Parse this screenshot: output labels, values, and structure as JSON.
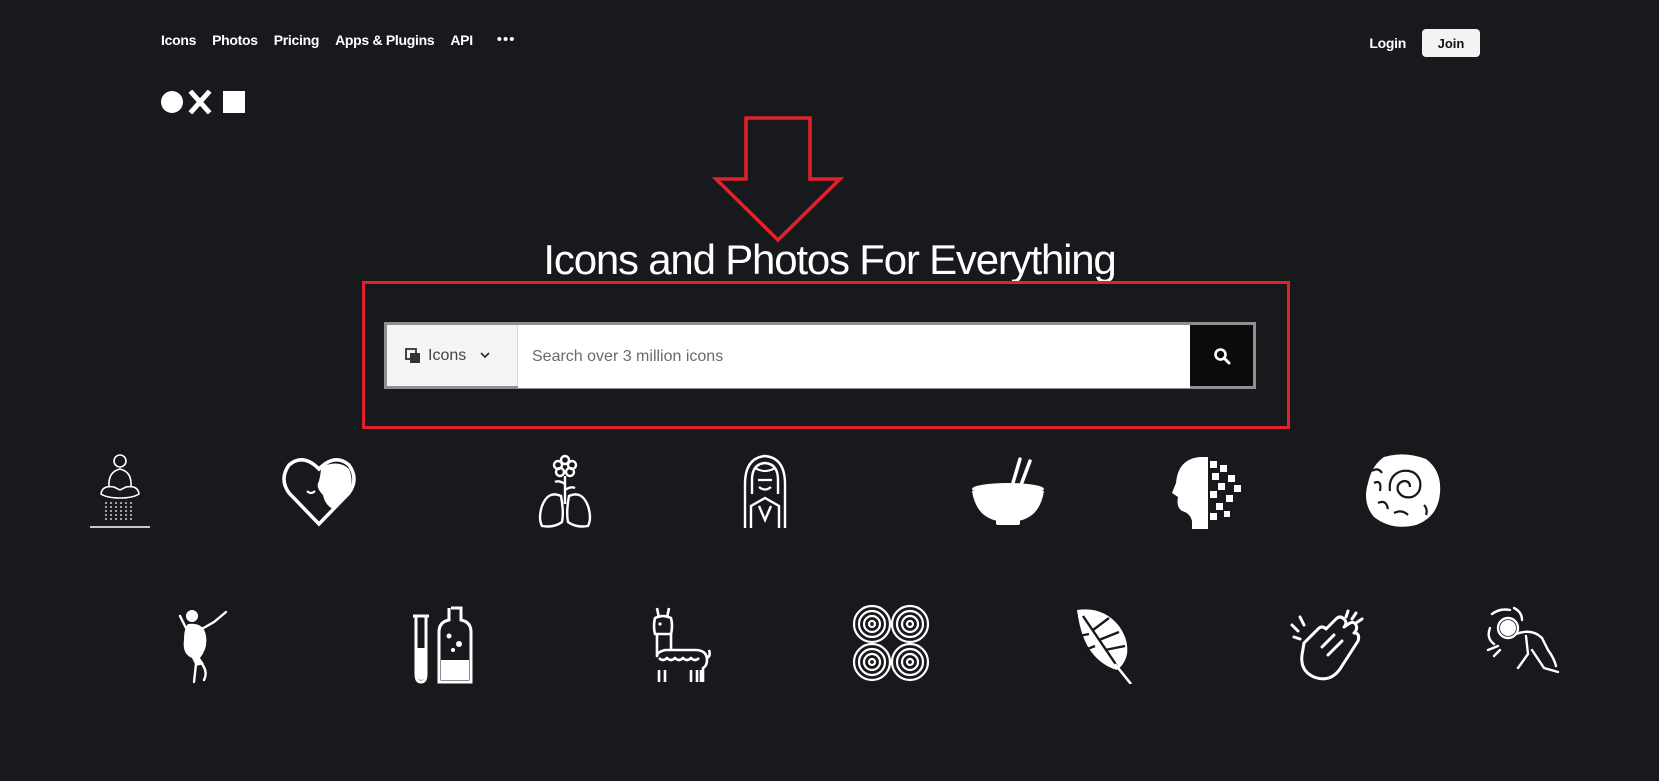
{
  "nav": {
    "items": [
      "Icons",
      "Photos",
      "Pricing",
      "Apps & Plugins",
      "API"
    ],
    "more_label": "•••"
  },
  "auth": {
    "login_label": "Login",
    "join_label": "Join"
  },
  "hero": {
    "title": "Icons and Photos For Everything"
  },
  "search": {
    "type_label": "Icons",
    "placeholder": "Search over 3 million icons"
  },
  "colors": {
    "background": "#18191d",
    "annotation": "#e3212a"
  },
  "featured_icons": [
    "meditation-icon",
    "heart-face-icon",
    "lungs-flower-icon",
    "hooded-woman-icon",
    "bowl-chopsticks-icon",
    "pixel-head-icon",
    "spiral-fossil-icon",
    "dancing-woman-icon",
    "lab-bottles-icon",
    "llama-icon",
    "spiral-pattern-icon",
    "monstera-leaf-icon",
    "clapping-hands-icon",
    "dizzy-person-icon"
  ]
}
